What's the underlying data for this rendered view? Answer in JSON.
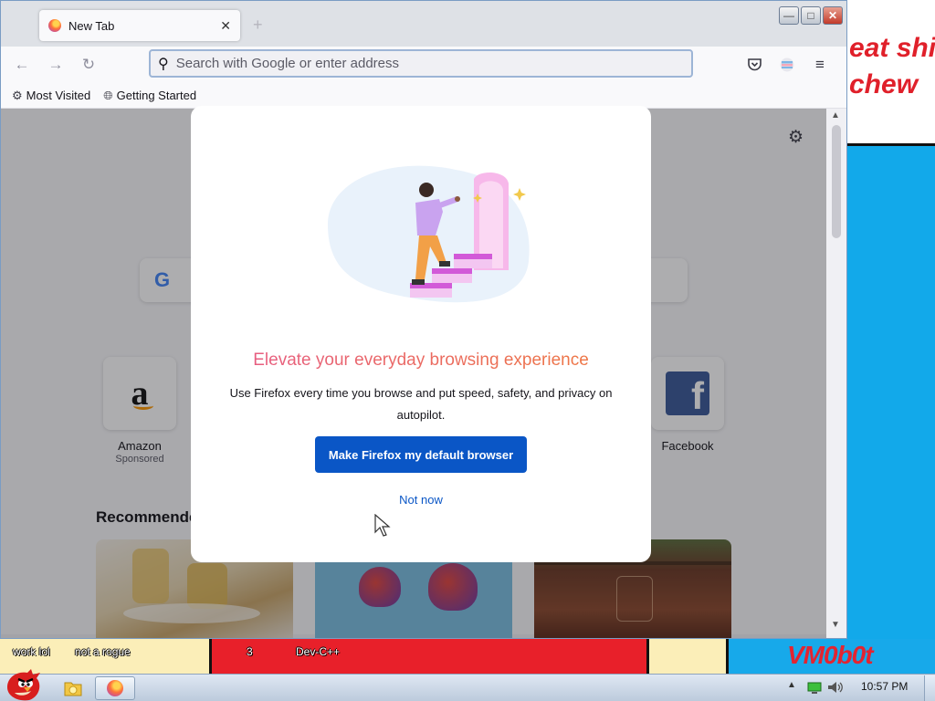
{
  "desktop": {
    "scrawl_line1": "eat shit",
    "scrawl_line2": "chew",
    "labels": [
      "work lol",
      "not a rogue",
      "3",
      "Dev-C++"
    ],
    "watermark": "VM0b0t"
  },
  "browser": {
    "tab_title": "New Tab",
    "new_tab_glyph": "+",
    "urlbar_placeholder": "Search with Google or enter address",
    "bookmarks": [
      {
        "label": "Most Visited",
        "icon": "gear-icon"
      },
      {
        "label": "Getting Started",
        "icon": "globe-icon"
      }
    ],
    "window_buttons": {
      "minimize": "—",
      "maximize": "□",
      "close": "✕"
    },
    "search_logo": "G",
    "shortcuts": [
      {
        "name": "Amazon",
        "sub": "Sponsored",
        "icon": "amazon-icon"
      },
      {
        "name": "Facebook",
        "sub": "",
        "icon": "facebook-icon"
      }
    ],
    "recommended_heading": "Recommende"
  },
  "modal": {
    "title": "Elevate your everyday browsing experience",
    "body": "Use Firefox every time you browse and put speed, safety, and privacy on autopilot.",
    "primary_button": "Make Firefox my default browser",
    "secondary_link": "Not now"
  },
  "taskbar": {
    "clock": "10:57 PM"
  }
}
